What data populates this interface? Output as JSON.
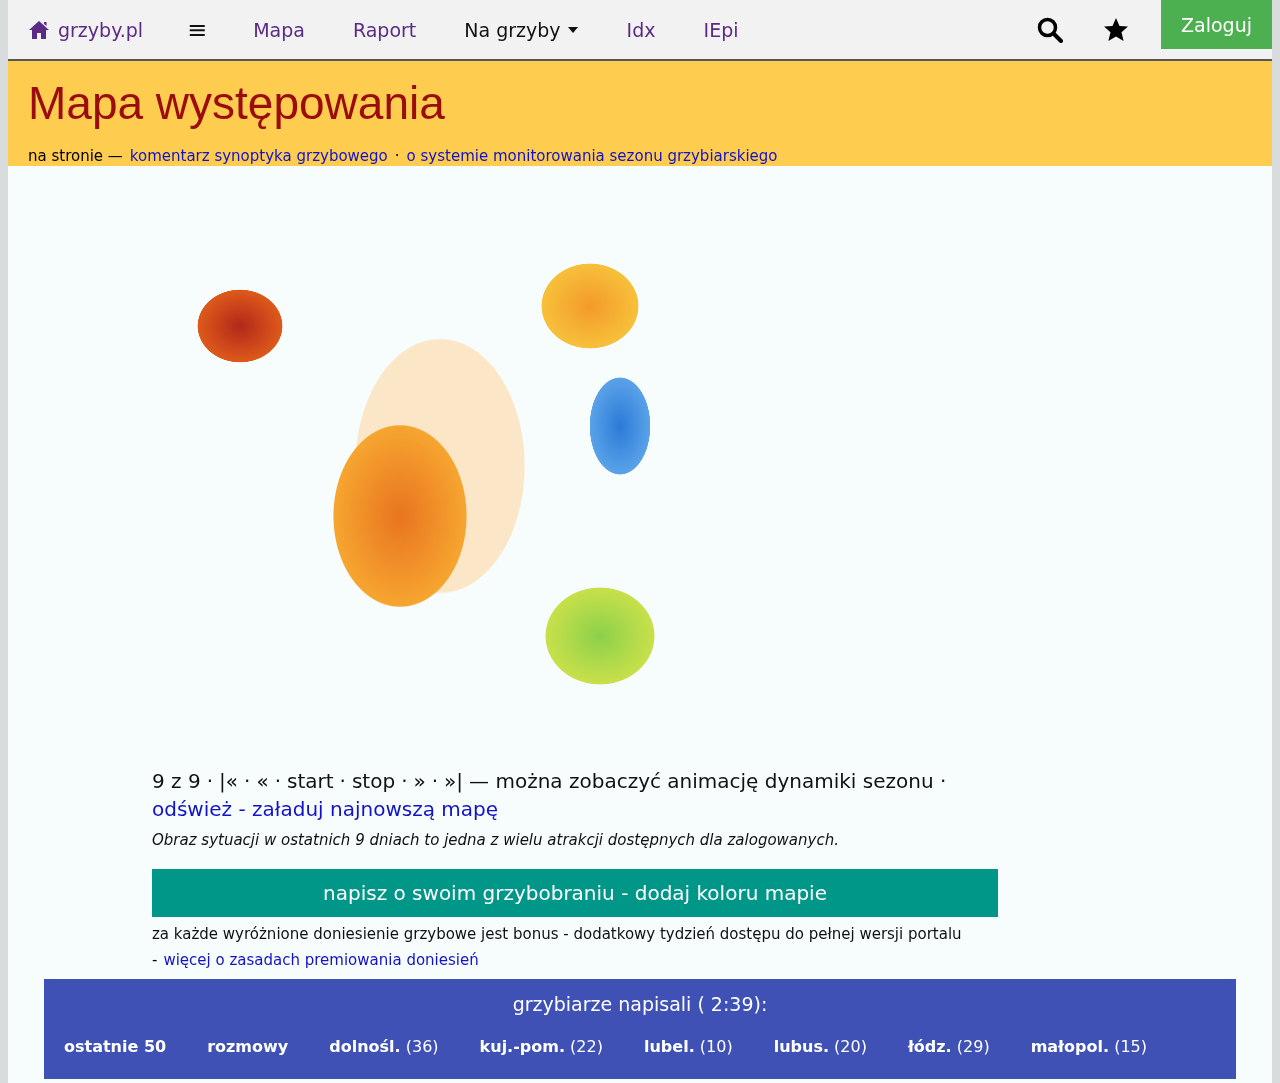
{
  "navbar": {
    "brand": "grzyby.pl",
    "menu_icon": "≡",
    "links": [
      {
        "label": "Mapa",
        "kind": "link"
      },
      {
        "label": "Raport",
        "kind": "link"
      },
      {
        "label": "Na grzyby",
        "kind": "dropdown"
      },
      {
        "label": "Idx",
        "kind": "link"
      },
      {
        "label": "IEpi",
        "kind": "link"
      }
    ],
    "login": "Zaloguj"
  },
  "banner": {
    "title": "Mapa występowania",
    "prefix": "na stronie —",
    "links": [
      "komentarz synoptyka grzybowego",
      "o systemie monitorowania sezonu grzybiarskiego"
    ],
    "separator": "·"
  },
  "animation": {
    "counter": "9 z 9",
    "separator": "·",
    "controls": [
      "|«",
      "«",
      "start",
      "stop",
      "»",
      "»|"
    ],
    "note": "— można zobaczyć animację dynamiki sezonu ·",
    "refresh": "odśwież - załaduj najnowszą mapę",
    "info": "Obraz sytuacji w ostatnich 9 dniach to jedna z wielu atrakcji dostępnych dla zalogowanych."
  },
  "cta": {
    "button": "napisz o swoim grzybobraniu - dodaj koloru mapie",
    "text": "za każde wyróżnione doniesienie grzybowe jest bonus - dodatkowy tydzień dostępu do pełnej wersji portalu",
    "prefix": "-",
    "link": "więcej o zasadach premiowania doniesień"
  },
  "reports": {
    "title": "grzybiarze napisali ( 2:39):",
    "tabs": [
      {
        "label": "ostatnie 50"
      },
      {
        "label": "rozmowy"
      },
      {
        "label": "dolnośl.",
        "count": "(36)"
      },
      {
        "label": "kuj.-pom.",
        "count": "(22)"
      },
      {
        "label": "lubel.",
        "count": "(10)"
      },
      {
        "label": "lubus.",
        "count": "(20)"
      },
      {
        "label": "łódz.",
        "count": "(29)"
      },
      {
        "label": "małopol.",
        "count": "(15)"
      }
    ]
  }
}
